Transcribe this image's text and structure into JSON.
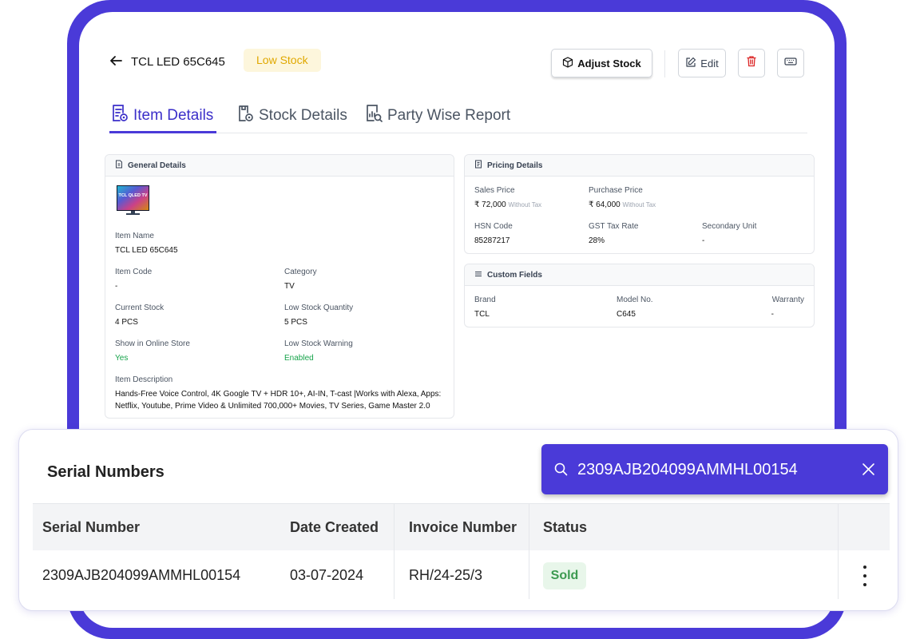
{
  "header": {
    "title": "TCL LED 65C645",
    "stock_badge": "Low Stock",
    "adjust_label": "Adjust Stock",
    "edit_label": "Edit"
  },
  "tabs": [
    {
      "label": "Item Details",
      "active": true
    },
    {
      "label": "Stock Details",
      "active": false
    },
    {
      "label": "Party Wise Report",
      "active": false
    }
  ],
  "general": {
    "heading": "General Details",
    "image_text": "TCL QLED TV",
    "item_name_label": "Item Name",
    "item_name": "TCL LED 65C645",
    "item_code_label": "Item Code",
    "item_code": "-",
    "category_label": "Category",
    "category": "TV",
    "current_stock_label": "Current Stock",
    "current_stock": "4 PCS",
    "low_stock_qty_label": "Low Stock Quantity",
    "low_stock_qty": "5 PCS",
    "online_store_label": "Show in Online Store",
    "online_store": "Yes",
    "low_stock_warning_label": "Low Stock Warning",
    "low_stock_warning": "Enabled",
    "description_label": "Item Description",
    "description": "Hands-Free Voice Control, 4K Google TV + HDR 10+, AI-IN, T-cast |Works with Alexa, Apps: Netflix, Youtube, Prime Video & Unlimited 700,000+ Movies, TV Series, Game Master 2.0"
  },
  "pricing": {
    "heading": "Pricing Details",
    "sales_price_label": "Sales Price",
    "sales_price": "₹ 72,000",
    "sales_tax_note": "Without Tax",
    "purchase_price_label": "Purchase Price",
    "purchase_price": "₹ 64,000",
    "purchase_tax_note": "Without Tax",
    "hsn_label": "HSN Code",
    "hsn": "85287217",
    "gst_label": "GST Tax Rate",
    "gst": "28%",
    "secondary_unit_label": "Secondary Unit",
    "secondary_unit": "-"
  },
  "custom_fields": {
    "heading": "Custom Fields",
    "brand_label": "Brand",
    "brand": "TCL",
    "model_label": "Model No.",
    "model": "C645",
    "warranty_label": "Warranty",
    "warranty": "-"
  },
  "serial_numbers": {
    "title": "Serial Numbers",
    "search_value": "2309AJB204099AMMHL00154",
    "columns": [
      "Serial Number",
      "Date Created",
      "Invoice Number",
      "Status"
    ],
    "rows": [
      {
        "serial": "2309AJB204099AMMHL00154",
        "date": "03-07-2024",
        "invoice": "RH/24-25/3",
        "status": "Sold"
      }
    ]
  },
  "colors": {
    "brand": "#4a3ad8",
    "low_stock_badge_text": "#e0a800",
    "low_stock_badge_bg": "#fdf6dc",
    "success": "#16a34a",
    "danger": "#dc2626"
  }
}
